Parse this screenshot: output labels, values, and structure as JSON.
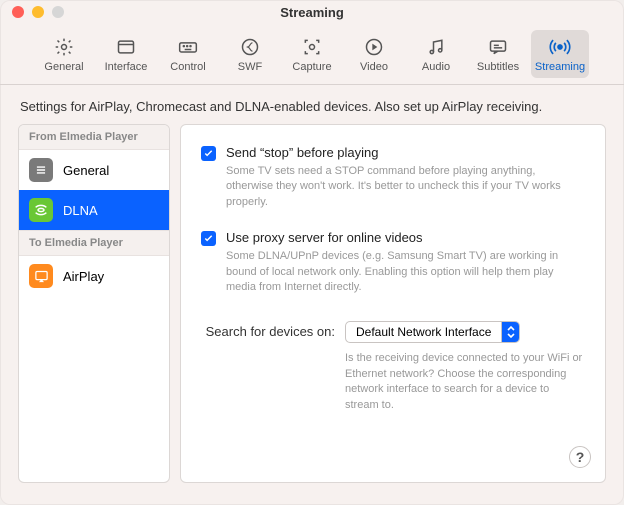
{
  "window": {
    "title": "Streaming"
  },
  "toolbar": {
    "items": [
      {
        "label": "General"
      },
      {
        "label": "Interface"
      },
      {
        "label": "Control"
      },
      {
        "label": "SWF"
      },
      {
        "label": "Capture"
      },
      {
        "label": "Video"
      },
      {
        "label": "Audio"
      },
      {
        "label": "Subtitles"
      },
      {
        "label": "Streaming"
      }
    ]
  },
  "description": "Settings for AirPlay, Chromecast and DLNA-enabled devices. Also set up AirPlay receiving.",
  "sidebar": {
    "section1_title": "From Elmedia Player",
    "section2_title": "To Elmedia Player",
    "items": {
      "general": "General",
      "dlna": "DLNA",
      "airplay": "AirPlay"
    }
  },
  "panel": {
    "opt1": {
      "title": "Send “stop” before playing",
      "desc": "Some TV sets need a STOP command before playing anything, otherwise they won't work. It's better to uncheck this if your TV works properly."
    },
    "opt2": {
      "title": "Use proxy server for online videos",
      "desc": "Some DLNA/UPnP devices (e.g. Samsung Smart TV) are working in bound of local network only. Enabling this option will help them play media from Internet directly."
    },
    "search": {
      "label": "Search for devices on:",
      "selected": "Default Network Interface",
      "hint": "Is the receiving device connected to your WiFi or Ethernet network? Choose the corresponding network interface to search for a device to stream to."
    },
    "help": "?"
  }
}
